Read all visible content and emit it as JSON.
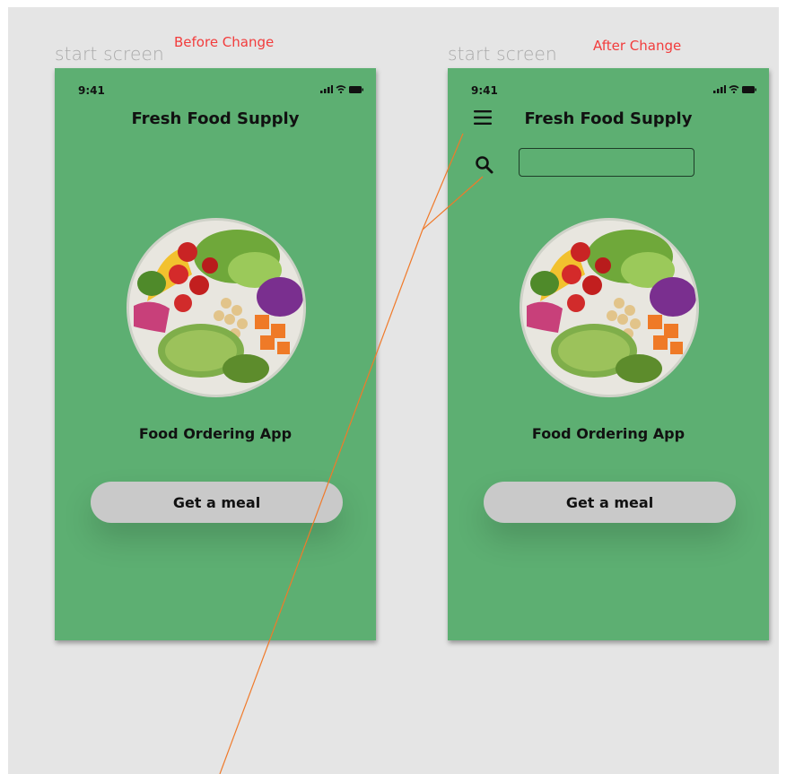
{
  "before": {
    "frame_label": "start screen",
    "change_label": "Before Change",
    "status_time": "9:41",
    "app_title": "Fresh Food Supply",
    "subtitle": "Food Ordering App",
    "cta_label": "Get a meal"
  },
  "after": {
    "frame_label": "start screen",
    "change_label": "After Change",
    "status_time": "9:41",
    "app_title": "Fresh Food Supply",
    "subtitle": "Food Ordering App",
    "cta_label": "Get a meal",
    "search": {
      "value": "",
      "placeholder": ""
    }
  },
  "icons": [
    "hamburger-menu-icon",
    "search-icon",
    "signal-icon",
    "wifi-icon",
    "battery-icon"
  ],
  "colors": {
    "phone_background": "#5daf72",
    "canvas_background": "#e5e5e5",
    "button_background": "#c9c9c9",
    "change_label": "#f23c3c",
    "frame_label": "#a9a9a9",
    "annotation_line": "#f07a2a"
  }
}
